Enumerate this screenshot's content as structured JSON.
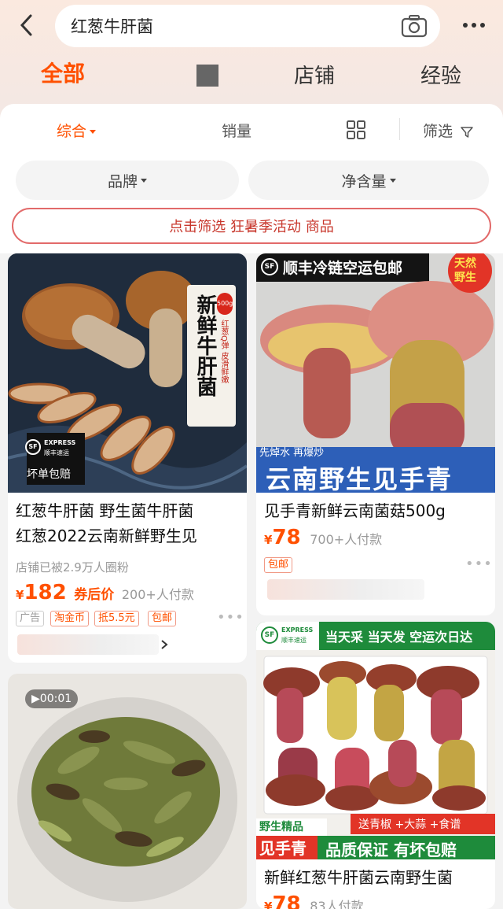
{
  "search": {
    "query": "红葱牛肝菌"
  },
  "category_tabs": [
    "全部",
    "店铺",
    "经验"
  ],
  "sort_bar": {
    "comprehensive": "综合",
    "sales": "销量",
    "filter": "筛选"
  },
  "filter_pills": [
    "品牌",
    "净含量"
  ],
  "promo_banner": "点击筛选 狂暑季活动 商品",
  "products": [
    {
      "title_line1": "红葱牛肝菌 野生菌牛肝菌",
      "title_line2": "红葱2022云南新鲜野生见",
      "shop_note": "店铺已被2.9万人圈粉",
      "currency": "¥",
      "price": "182",
      "coupon_label": "券后价",
      "paid_count": "200+人付款",
      "tags": [
        "广告",
        "淘金币",
        "抵5.5元",
        "包邮"
      ],
      "image_text": {
        "headline": "新鲜牛肝菌",
        "weight": "500g",
        "side_note": "红葱Q弹 皮滑鲜嫩",
        "logo": "SF",
        "logo_express": "EXPRESS",
        "logo_cn": "顺丰速运",
        "guarantee": "坏单包赔"
      }
    },
    {
      "title": "见手青新鲜云南菌菇500g",
      "currency": "¥",
      "price": "78",
      "paid_count": "700+人付款",
      "tags": [
        "包邮"
      ],
      "image_text": {
        "banner": "顺丰冷链空运包邮",
        "logo": "SF",
        "badge_line1": "天然",
        "badge_line2": "野生",
        "caption_small": "先焯水 再爆炒",
        "caption_big": "云南野生见手青"
      }
    },
    {
      "video_time": "00:01"
    },
    {
      "title": "新鲜红葱牛肝菌云南野生菌",
      "currency": "¥",
      "price": "78",
      "paid_count": "83人付款",
      "image_text": {
        "logo": "SF",
        "logo_express": "EXPRESS",
        "logo_cn": "顺丰速运",
        "banner": "当天采 当天发 空运次日达",
        "tag_line1": "野生精品",
        "tag_line2": "见手青",
        "gift": "送青椒 +大蒜 +食谱",
        "bottom": "品质保证 有坏包赔"
      }
    }
  ]
}
